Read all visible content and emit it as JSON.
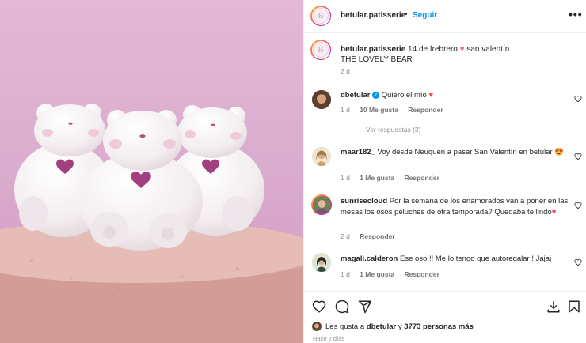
{
  "header": {
    "avatar_letter": "B",
    "username": "betular.patisserie",
    "separator": "•",
    "follow_label": "Seguir",
    "more_label": "•••"
  },
  "caption": {
    "username": "betular.patisserie",
    "text_before": "14 de frebrero",
    "heart": "♥",
    "text_after": "san valentín",
    "line2": "THE LOVELY BEAR",
    "time": "2 d"
  },
  "comments": [
    {
      "username": "dbetular",
      "verified": "✓",
      "text": "Quiero el mío",
      "emoji": "♥",
      "time": "1 d",
      "likes": "10 Me gusta",
      "reply": "Responder"
    },
    {
      "username": "maar182_",
      "text": "Voy desde Neuquén a pasar San Valentín en betular",
      "emoji": "😍",
      "time": "1 d",
      "likes": "1 Me gusta",
      "reply": "Responder"
    },
    {
      "username": "sunrisecloud",
      "text": "Por la semana de los enamorados van a poner en las mesas los osos peluches de otra temporada? Quedaba te lindo",
      "emoji": "♥",
      "time": "2 d",
      "reply": "Responder"
    },
    {
      "username": "magali.calderon",
      "text": "Ese oso!!! Me lo tengo que autoregalar ! Jajaj",
      "time": "1 d",
      "likes": "1 Me gusta",
      "reply": "Responder"
    }
  ],
  "replies_label": "Ver respuestas (3)",
  "likes": {
    "prefix": "Les gusta a",
    "user": "dbetular",
    "middle": "y",
    "count": "3773 personas más"
  },
  "post_time": "Hace 2 días",
  "colors": {
    "accent": "#0095f6",
    "heart_red": "#ed4956",
    "photo_bg": "#dcaed0",
    "bear": "#f6f1f3",
    "bear_heart": "#a2407f",
    "macaron": "#d9a9a3"
  },
  "icons": [
    "more-icon",
    "verified-icon",
    "like-icon",
    "comment-icon",
    "share-icon",
    "save-icon",
    "download-icon"
  ]
}
